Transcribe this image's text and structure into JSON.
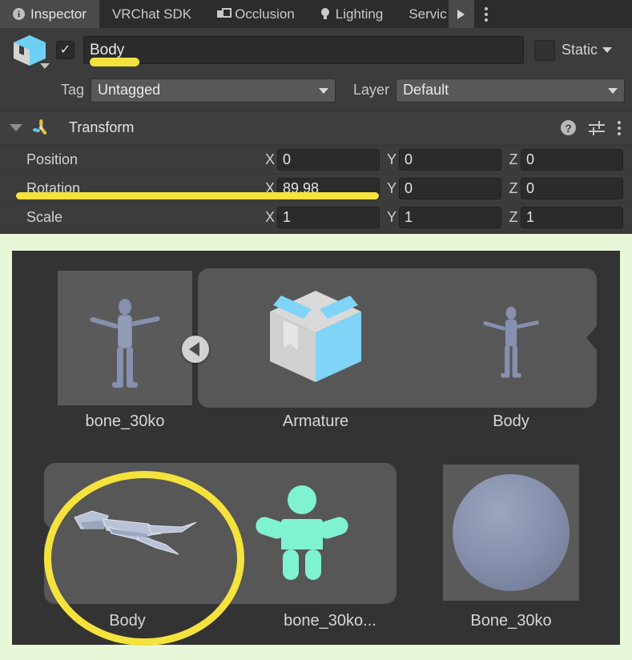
{
  "window": {
    "tabs": [
      {
        "label": "Inspector",
        "icon": "info-icon",
        "active": true
      },
      {
        "label": "VRChat SDK",
        "icon": "none",
        "active": false
      },
      {
        "label": "Occlusion",
        "icon": "occlusion-icon",
        "active": false
      },
      {
        "label": "Lighting",
        "icon": "lightbulb-icon",
        "active": false
      },
      {
        "label": "Servic",
        "icon": "none",
        "active": false
      }
    ],
    "overflow_icon": "chevron-right-icon",
    "menu_icon": "kebab-menu-icon"
  },
  "gameobject": {
    "icon": "prefab-cube-icon",
    "enabled_checkbox": "✓",
    "name": "Body",
    "name_highlighted": true,
    "static_label": "Static",
    "tag_label": "Tag",
    "tag_value": "Untagged",
    "layer_label": "Layer",
    "layer_value": "Default"
  },
  "transform": {
    "title": "Transform",
    "icon": "transform-gizmo-icon",
    "help_icon": "help-icon",
    "preset_icon": "preset-icon",
    "menu_icon": "kebab-menu-icon",
    "rows": [
      {
        "label": "Position",
        "x": "0",
        "y": "0",
        "z": "0",
        "highlighted": false
      },
      {
        "label": "Rotation",
        "x": "89.98",
        "y": "0",
        "z": "0",
        "highlighted": true
      },
      {
        "label": "Scale",
        "x": "1",
        "y": "1",
        "z": "1",
        "highlighted": false
      }
    ],
    "axes": [
      "X",
      "Y",
      "Z"
    ]
  },
  "project": {
    "back_button_icon": "back-arrow-icon",
    "row1": [
      {
        "label": "bone_30ko",
        "thumb": "humanoid-mesh-preview"
      },
      {
        "label": "Armature",
        "thumb": "prefab-box-icon"
      },
      {
        "label": "Body",
        "thumb": "humanoid-mesh-preview"
      }
    ],
    "row2": [
      {
        "label": "Body",
        "thumb": "mesh-lying-preview",
        "annotated": true
      },
      {
        "label": "bone_30ko...",
        "thumb": "avatar-humanoid-icon"
      },
      {
        "label": "Bone_30ko",
        "thumb": "material-sphere-preview"
      }
    ]
  },
  "annotations": {
    "name_underline_color": "#f2e23f",
    "rotation_underline_color": "#f5e23d",
    "circle_color": "#f5e23d",
    "frame_color": "#e9f7d9"
  },
  "colors": {
    "panel_bg": "#3c3c3c",
    "tabbar_bg": "#2c2c2c",
    "field_bg": "#2b2b2b",
    "dropdown_bg": "#585858",
    "project_bg": "#333333",
    "accent_cyan": "#6fd0f5",
    "avatar_teal": "#7ff2d2",
    "mesh_blue": "#8591ae"
  }
}
